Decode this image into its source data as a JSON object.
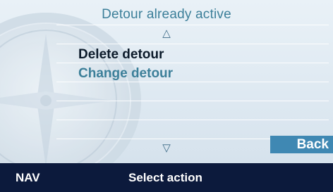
{
  "screen": {
    "title": "Detour already active",
    "scroll_up_icon": "triangle-up-outline",
    "scroll_down_icon": "triangle-down-outline"
  },
  "menu": {
    "items": [
      {
        "label": "Delete detour",
        "selected": true
      },
      {
        "label": "Change detour",
        "selected": false
      }
    ]
  },
  "buttons": {
    "back_label": "Back"
  },
  "status_bar": {
    "mode_label": "NAV",
    "prompt": "Select action"
  },
  "colors": {
    "title": "#3c7f99",
    "selected_item": "#0b1a2a",
    "unselected_item": "#3c7f99",
    "back_button": "#3f88b3",
    "status_bar": "#0c1a3c"
  }
}
